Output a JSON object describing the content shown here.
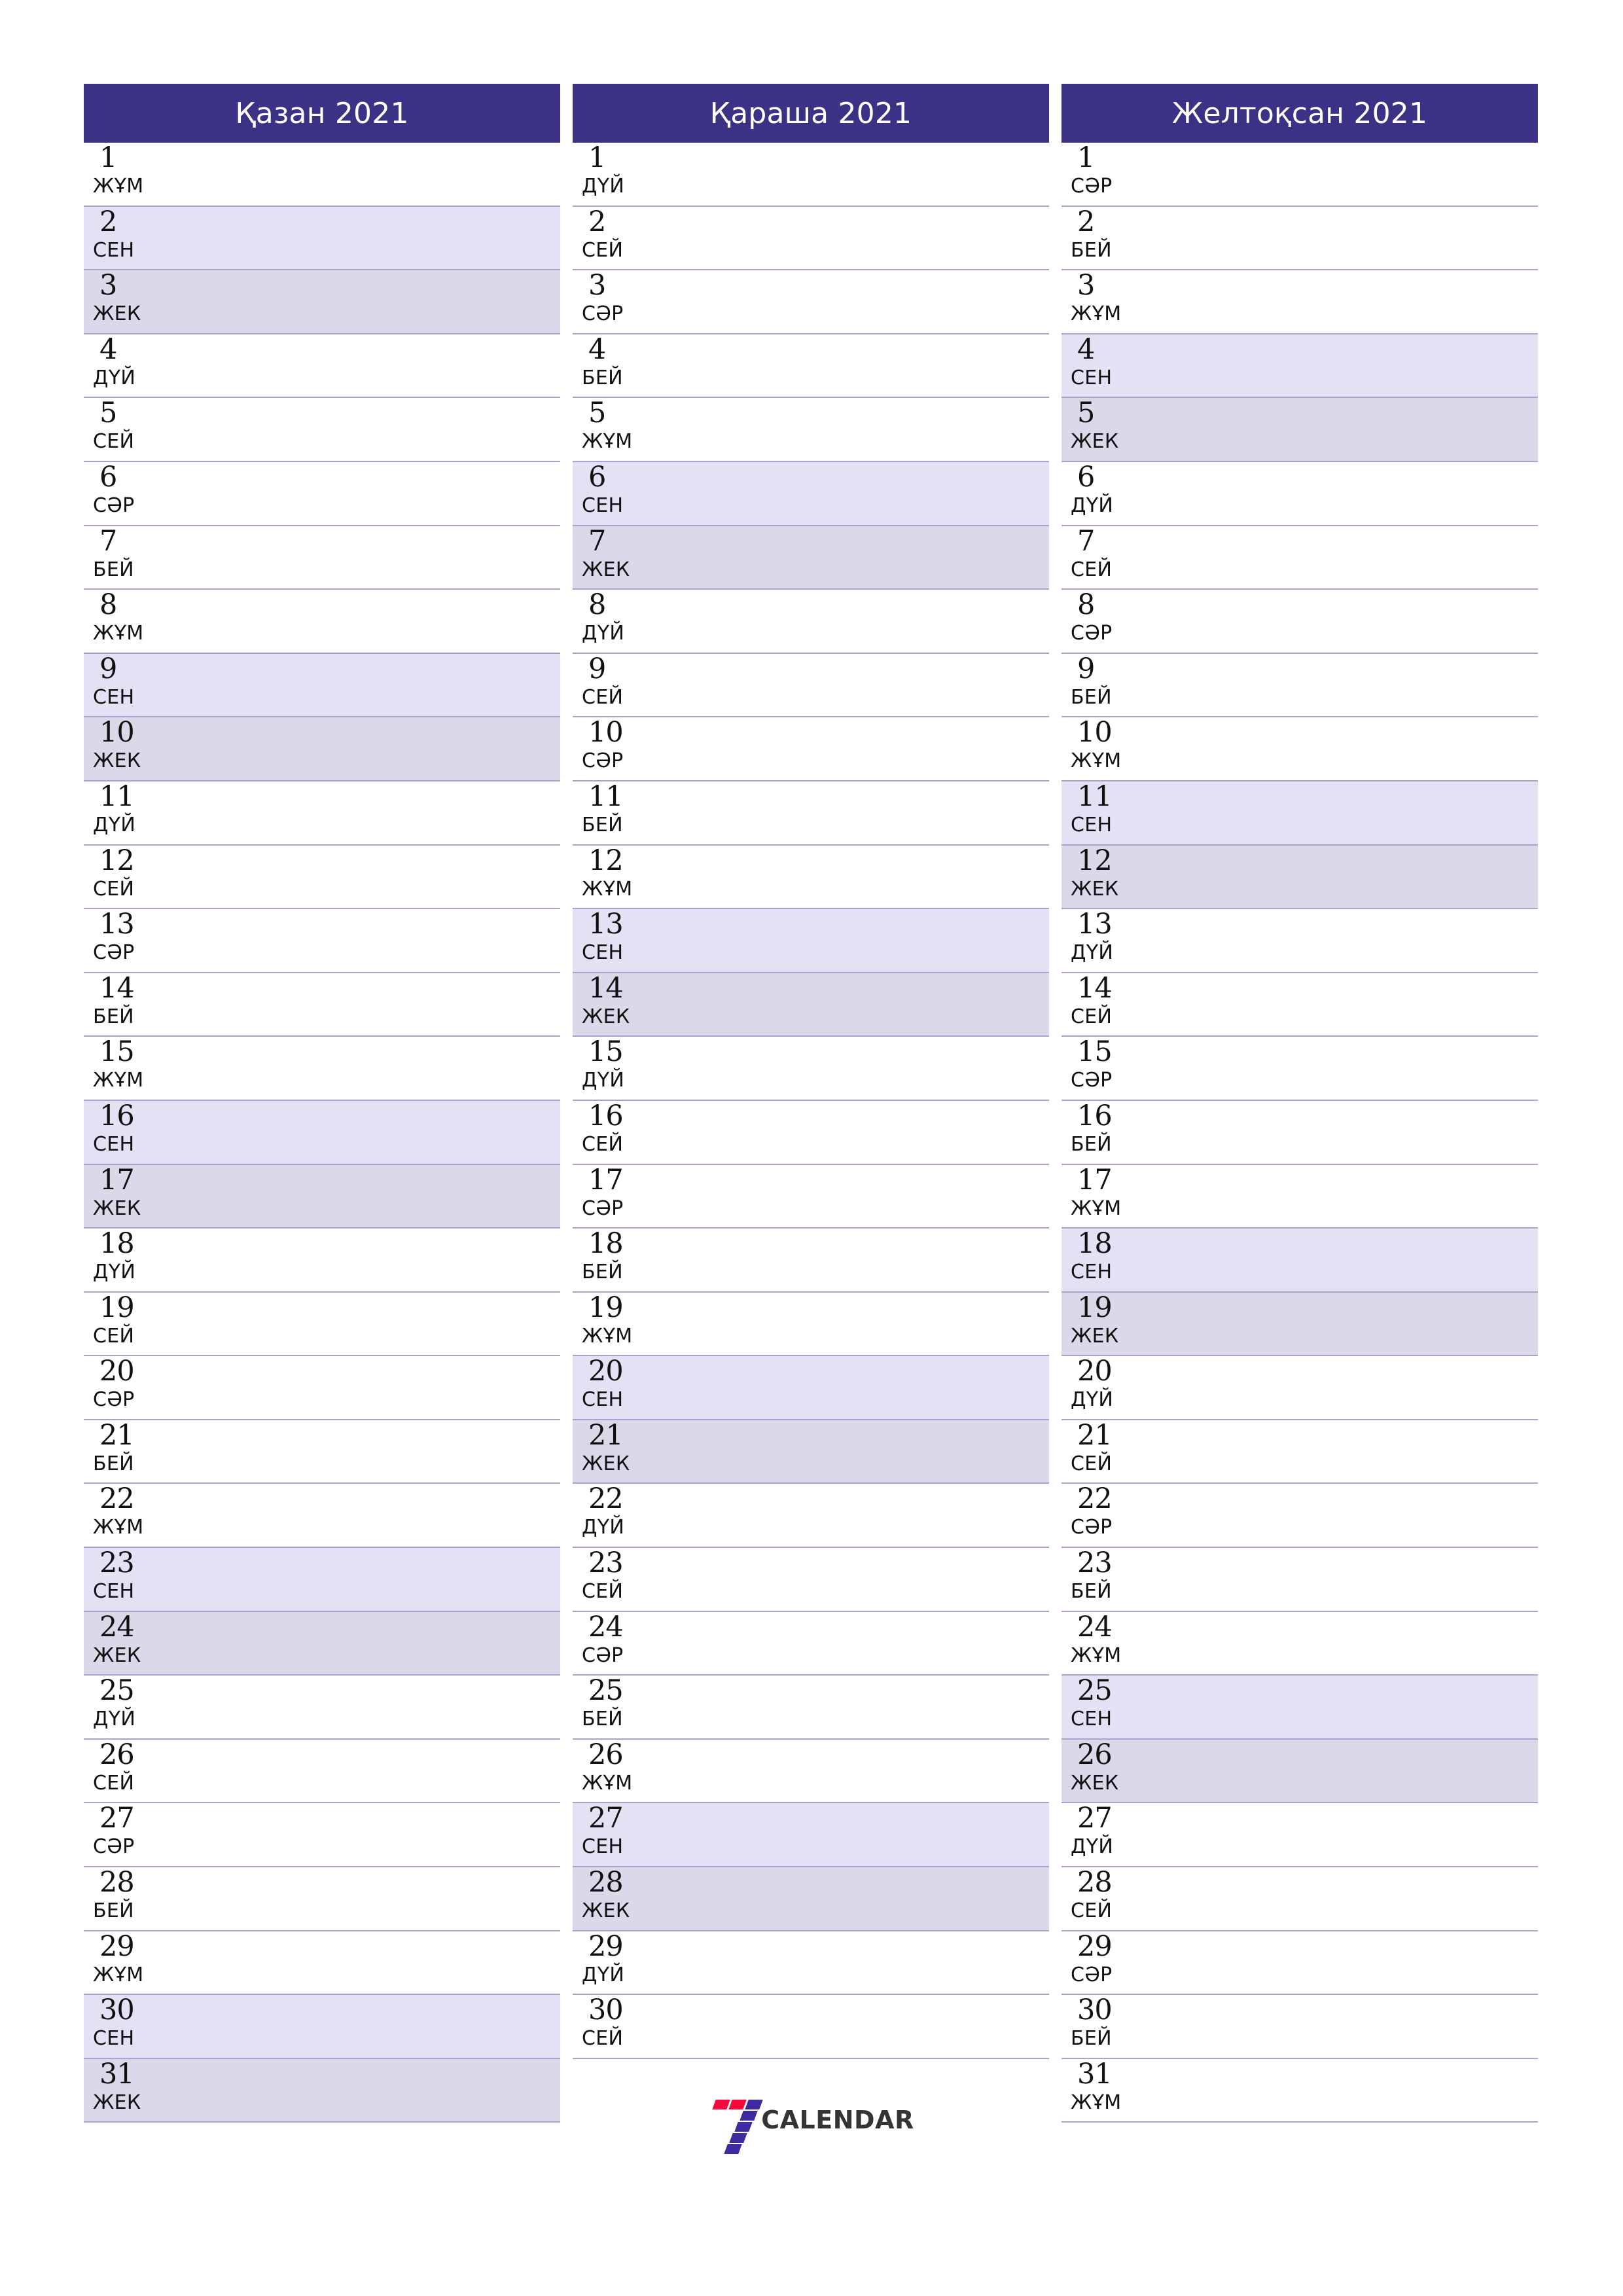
{
  "brand": {
    "name": "CALENDAR",
    "mark_icon": "seven-logo-icon",
    "red": "#f60a3c",
    "purple": "#3f2ba0"
  },
  "theme": {
    "header_bg": "#3b3285",
    "header_text": "#ffffff",
    "saturday_bg": "#e3e2f4",
    "sunday_bg": "#dcd8ea",
    "row_line": "#a9a3cc",
    "text": "#111111",
    "page_bg": "#ffffff"
  },
  "weekday_abbr": {
    "mon": "ДҮЙ",
    "tue": "СЕЙ",
    "wed": "СӘР",
    "thu": "БЕЙ",
    "fri": "ЖҰМ",
    "sat": "СЕН",
    "sun": "ЖЕК"
  },
  "months": [
    {
      "title": "Қазан 2021",
      "days": [
        {
          "num": "1",
          "abbr": "ЖҰМ",
          "type": "weekday"
        },
        {
          "num": "2",
          "abbr": "СЕН",
          "type": "sat"
        },
        {
          "num": "3",
          "abbr": "ЖЕК",
          "type": "sun"
        },
        {
          "num": "4",
          "abbr": "ДҮЙ",
          "type": "weekday"
        },
        {
          "num": "5",
          "abbr": "СЕЙ",
          "type": "weekday"
        },
        {
          "num": "6",
          "abbr": "СӘР",
          "type": "weekday"
        },
        {
          "num": "7",
          "abbr": "БЕЙ",
          "type": "weekday"
        },
        {
          "num": "8",
          "abbr": "ЖҰМ",
          "type": "weekday"
        },
        {
          "num": "9",
          "abbr": "СЕН",
          "type": "sat"
        },
        {
          "num": "10",
          "abbr": "ЖЕК",
          "type": "sun"
        },
        {
          "num": "11",
          "abbr": "ДҮЙ",
          "type": "weekday"
        },
        {
          "num": "12",
          "abbr": "СЕЙ",
          "type": "weekday"
        },
        {
          "num": "13",
          "abbr": "СӘР",
          "type": "weekday"
        },
        {
          "num": "14",
          "abbr": "БЕЙ",
          "type": "weekday"
        },
        {
          "num": "15",
          "abbr": "ЖҰМ",
          "type": "weekday"
        },
        {
          "num": "16",
          "abbr": "СЕН",
          "type": "sat"
        },
        {
          "num": "17",
          "abbr": "ЖЕК",
          "type": "sun"
        },
        {
          "num": "18",
          "abbr": "ДҮЙ",
          "type": "weekday"
        },
        {
          "num": "19",
          "abbr": "СЕЙ",
          "type": "weekday"
        },
        {
          "num": "20",
          "abbr": "СӘР",
          "type": "weekday"
        },
        {
          "num": "21",
          "abbr": "БЕЙ",
          "type": "weekday"
        },
        {
          "num": "22",
          "abbr": "ЖҰМ",
          "type": "weekday"
        },
        {
          "num": "23",
          "abbr": "СЕН",
          "type": "sat"
        },
        {
          "num": "24",
          "abbr": "ЖЕК",
          "type": "sun"
        },
        {
          "num": "25",
          "abbr": "ДҮЙ",
          "type": "weekday"
        },
        {
          "num": "26",
          "abbr": "СЕЙ",
          "type": "weekday"
        },
        {
          "num": "27",
          "abbr": "СӘР",
          "type": "weekday"
        },
        {
          "num": "28",
          "abbr": "БЕЙ",
          "type": "weekday"
        },
        {
          "num": "29",
          "abbr": "ЖҰМ",
          "type": "weekday"
        },
        {
          "num": "30",
          "abbr": "СЕН",
          "type": "sat"
        },
        {
          "num": "31",
          "abbr": "ЖЕК",
          "type": "sun"
        }
      ]
    },
    {
      "title": "Қараша 2021",
      "days": [
        {
          "num": "1",
          "abbr": "ДҮЙ",
          "type": "weekday"
        },
        {
          "num": "2",
          "abbr": "СЕЙ",
          "type": "weekday"
        },
        {
          "num": "3",
          "abbr": "СӘР",
          "type": "weekday"
        },
        {
          "num": "4",
          "abbr": "БЕЙ",
          "type": "weekday"
        },
        {
          "num": "5",
          "abbr": "ЖҰМ",
          "type": "weekday"
        },
        {
          "num": "6",
          "abbr": "СЕН",
          "type": "sat"
        },
        {
          "num": "7",
          "abbr": "ЖЕК",
          "type": "sun"
        },
        {
          "num": "8",
          "abbr": "ДҮЙ",
          "type": "weekday"
        },
        {
          "num": "9",
          "abbr": "СЕЙ",
          "type": "weekday"
        },
        {
          "num": "10",
          "abbr": "СӘР",
          "type": "weekday"
        },
        {
          "num": "11",
          "abbr": "БЕЙ",
          "type": "weekday"
        },
        {
          "num": "12",
          "abbr": "ЖҰМ",
          "type": "weekday"
        },
        {
          "num": "13",
          "abbr": "СЕН",
          "type": "sat"
        },
        {
          "num": "14",
          "abbr": "ЖЕК",
          "type": "sun"
        },
        {
          "num": "15",
          "abbr": "ДҮЙ",
          "type": "weekday"
        },
        {
          "num": "16",
          "abbr": "СЕЙ",
          "type": "weekday"
        },
        {
          "num": "17",
          "abbr": "СӘР",
          "type": "weekday"
        },
        {
          "num": "18",
          "abbr": "БЕЙ",
          "type": "weekday"
        },
        {
          "num": "19",
          "abbr": "ЖҰМ",
          "type": "weekday"
        },
        {
          "num": "20",
          "abbr": "СЕН",
          "type": "sat"
        },
        {
          "num": "21",
          "abbr": "ЖЕК",
          "type": "sun"
        },
        {
          "num": "22",
          "abbr": "ДҮЙ",
          "type": "weekday"
        },
        {
          "num": "23",
          "abbr": "СЕЙ",
          "type": "weekday"
        },
        {
          "num": "24",
          "abbr": "СӘР",
          "type": "weekday"
        },
        {
          "num": "25",
          "abbr": "БЕЙ",
          "type": "weekday"
        },
        {
          "num": "26",
          "abbr": "ЖҰМ",
          "type": "weekday"
        },
        {
          "num": "27",
          "abbr": "СЕН",
          "type": "sat"
        },
        {
          "num": "28",
          "abbr": "ЖЕК",
          "type": "sun"
        },
        {
          "num": "29",
          "abbr": "ДҮЙ",
          "type": "weekday"
        },
        {
          "num": "30",
          "abbr": "СЕЙ",
          "type": "weekday"
        },
        {
          "num": "",
          "abbr": "",
          "type": "blank"
        }
      ]
    },
    {
      "title": "Желтоқсан 2021",
      "days": [
        {
          "num": "1",
          "abbr": "СӘР",
          "type": "weekday"
        },
        {
          "num": "2",
          "abbr": "БЕЙ",
          "type": "weekday"
        },
        {
          "num": "3",
          "abbr": "ЖҰМ",
          "type": "weekday"
        },
        {
          "num": "4",
          "abbr": "СЕН",
          "type": "sat"
        },
        {
          "num": "5",
          "abbr": "ЖЕК",
          "type": "sun"
        },
        {
          "num": "6",
          "abbr": "ДҮЙ",
          "type": "weekday"
        },
        {
          "num": "7",
          "abbr": "СЕЙ",
          "type": "weekday"
        },
        {
          "num": "8",
          "abbr": "СӘР",
          "type": "weekday"
        },
        {
          "num": "9",
          "abbr": "БЕЙ",
          "type": "weekday"
        },
        {
          "num": "10",
          "abbr": "ЖҰМ",
          "type": "weekday"
        },
        {
          "num": "11",
          "abbr": "СЕН",
          "type": "sat"
        },
        {
          "num": "12",
          "abbr": "ЖЕК",
          "type": "sun"
        },
        {
          "num": "13",
          "abbr": "ДҮЙ",
          "type": "weekday"
        },
        {
          "num": "14",
          "abbr": "СЕЙ",
          "type": "weekday"
        },
        {
          "num": "15",
          "abbr": "СӘР",
          "type": "weekday"
        },
        {
          "num": "16",
          "abbr": "БЕЙ",
          "type": "weekday"
        },
        {
          "num": "17",
          "abbr": "ЖҰМ",
          "type": "weekday"
        },
        {
          "num": "18",
          "abbr": "СЕН",
          "type": "sat"
        },
        {
          "num": "19",
          "abbr": "ЖЕК",
          "type": "sun"
        },
        {
          "num": "20",
          "abbr": "ДҮЙ",
          "type": "weekday"
        },
        {
          "num": "21",
          "abbr": "СЕЙ",
          "type": "weekday"
        },
        {
          "num": "22",
          "abbr": "СӘР",
          "type": "weekday"
        },
        {
          "num": "23",
          "abbr": "БЕЙ",
          "type": "weekday"
        },
        {
          "num": "24",
          "abbr": "ЖҰМ",
          "type": "weekday"
        },
        {
          "num": "25",
          "abbr": "СЕН",
          "type": "sat"
        },
        {
          "num": "26",
          "abbr": "ЖЕК",
          "type": "sun"
        },
        {
          "num": "27",
          "abbr": "ДҮЙ",
          "type": "weekday"
        },
        {
          "num": "28",
          "abbr": "СЕЙ",
          "type": "weekday"
        },
        {
          "num": "29",
          "abbr": "СӘР",
          "type": "weekday"
        },
        {
          "num": "30",
          "abbr": "БЕЙ",
          "type": "weekday"
        },
        {
          "num": "31",
          "abbr": "ЖҰМ",
          "type": "weekday"
        }
      ]
    }
  ]
}
